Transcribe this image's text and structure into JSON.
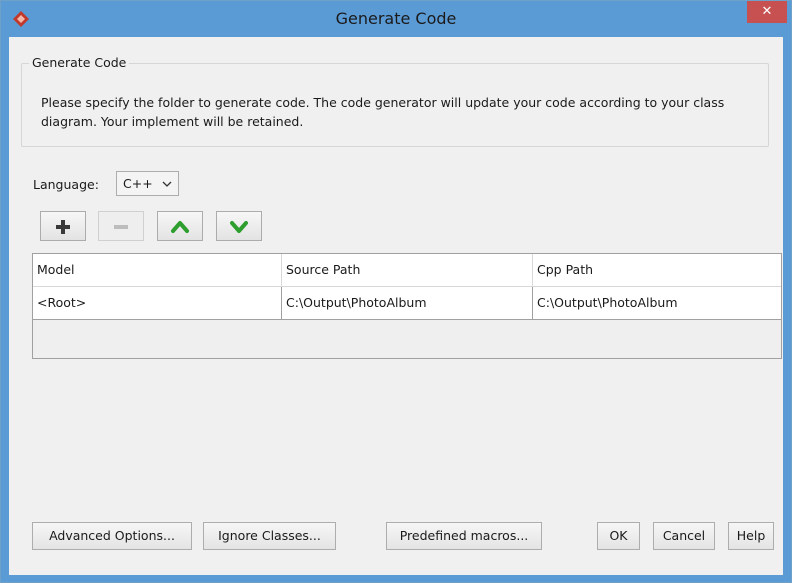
{
  "window": {
    "title": "Generate Code",
    "close_label": "✕",
    "accent_color": "#5b9bd5",
    "close_color": "#c75050"
  },
  "group": {
    "title": "Generate Code",
    "description": "Please specify the folder to generate code. The code generator will update your code according to your class diagram. Your implement will be retained."
  },
  "language": {
    "label": "Language:",
    "value": "C++"
  },
  "toolbar": {
    "icons": [
      "plus-icon",
      "minus-icon",
      "move-up-icon",
      "move-down-icon"
    ]
  },
  "table": {
    "columns": [
      "Model",
      "Source Path",
      "Cpp Path"
    ],
    "rows": [
      [
        "<Root>",
        "C:\\Output\\PhotoAlbum",
        "C:\\Output\\PhotoAlbum"
      ]
    ]
  },
  "buttons": {
    "advanced": "Advanced Options...",
    "ignore": "Ignore Classes...",
    "macros": "Predefined macros...",
    "ok": "OK",
    "cancel": "Cancel",
    "help": "Help"
  }
}
